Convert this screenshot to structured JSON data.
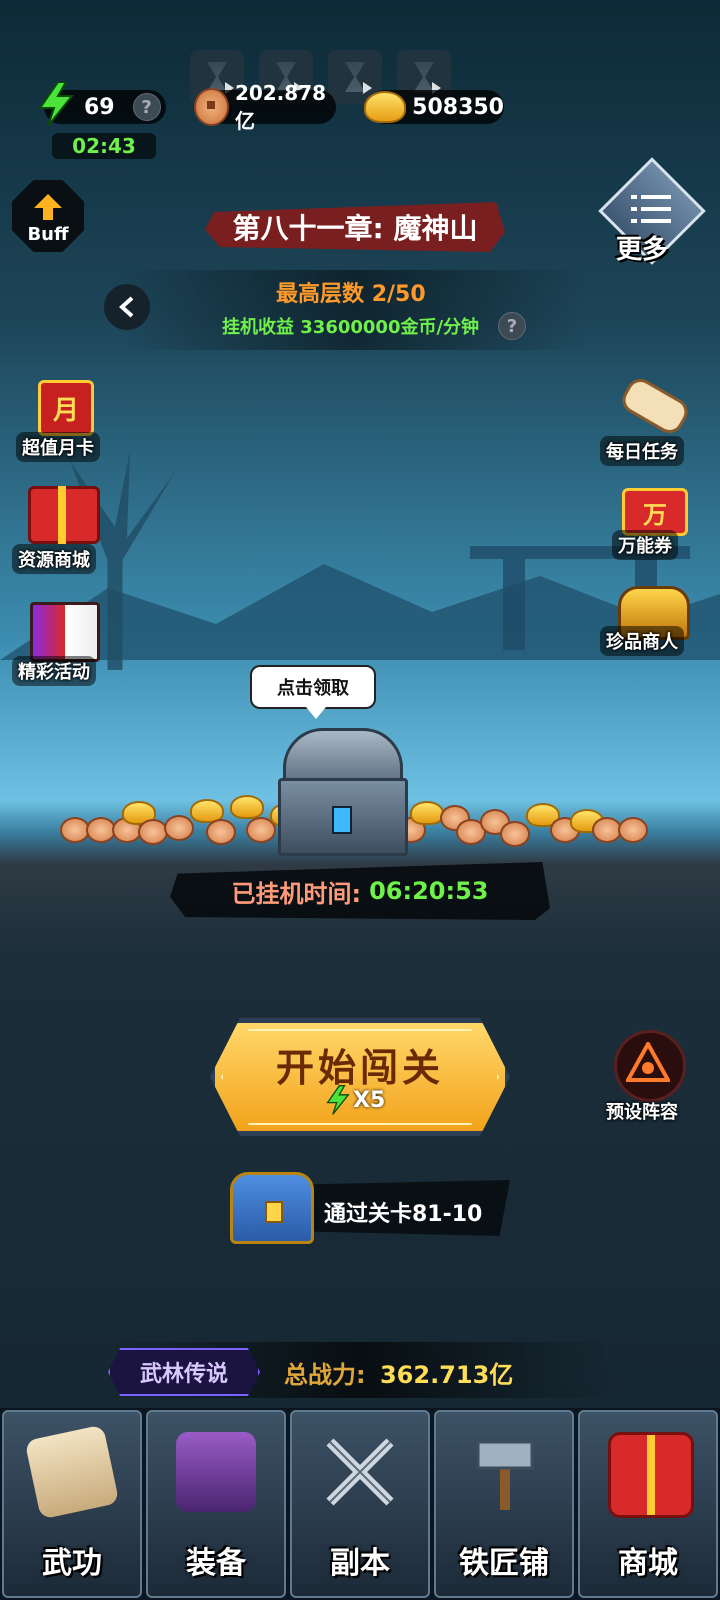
{
  "energy": {
    "value": "69",
    "help": "?",
    "timer": "02:43"
  },
  "copper": {
    "value": "202.878亿"
  },
  "gold": {
    "value": "508350"
  },
  "buff": {
    "label": "Buff"
  },
  "more": {
    "label": "更多"
  },
  "chapter": {
    "title": "第八十一章: 魔神山",
    "max_floor_label": "最高层数",
    "max_floor_value": "2/50",
    "income_label": "挂机收益",
    "income_value": "33600000金币/分钟",
    "help": "?"
  },
  "left_menu": [
    {
      "label": "超值月卡",
      "icon": "月"
    },
    {
      "label": "资源商城",
      "icon": "万"
    },
    {
      "label": "精彩活动",
      "icon": "册"
    }
  ],
  "right_menu": [
    {
      "label": "每日任务"
    },
    {
      "label": "万能券",
      "icon": "万"
    },
    {
      "label": "珍品商人"
    }
  ],
  "claim_bubble": "点击领取",
  "idle": {
    "label": "已挂机时间:",
    "value": "06:20:53"
  },
  "start": {
    "label": "开始闯关",
    "cost": "X5"
  },
  "formation": {
    "label": "预设阵容"
  },
  "pass": {
    "label": "通过关卡81-10"
  },
  "power": {
    "badge": "武林传说",
    "label": "总战力:",
    "value": "362.713亿"
  },
  "nav": [
    {
      "label": "武功"
    },
    {
      "label": "装备"
    },
    {
      "label": "副本"
    },
    {
      "label": "铁匠铺"
    },
    {
      "label": "商城"
    }
  ],
  "colors": {
    "accent_green": "#6ff04a",
    "title_orange": "#ff9a2a",
    "gold": "#ffd86a",
    "chapter_red": "#7a1f1f"
  }
}
